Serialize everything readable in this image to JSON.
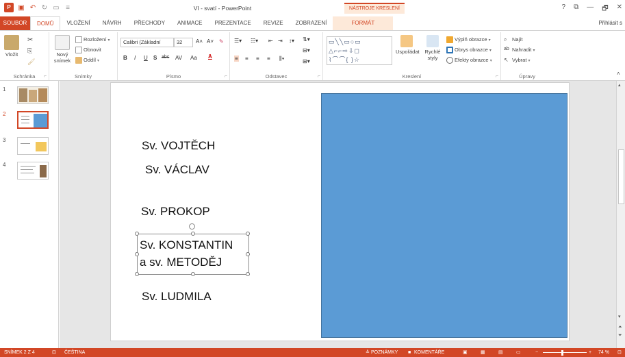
{
  "window": {
    "title": "VI - svatí - PowerPoint",
    "context_header": "NÁSTROJE KRESLENÍ",
    "controls": [
      "?",
      "⧉",
      "—",
      "🗗",
      "✕"
    ]
  },
  "tabs": [
    {
      "label": "SOUBOR"
    },
    {
      "label": "DOMŮ"
    },
    {
      "label": "VLOŽENÍ"
    },
    {
      "label": "NÁVRH"
    },
    {
      "label": "PŘECHODY"
    },
    {
      "label": "ANIMACE"
    },
    {
      "label": "PREZENTACE"
    },
    {
      "label": "REVIZE"
    },
    {
      "label": "ZOBRAZENÍ"
    },
    {
      "label": "FORMÁT"
    }
  ],
  "signin": "Přihlásit s",
  "ribbon": {
    "clipboard": {
      "paste": "Vložit",
      "group": "Schránka"
    },
    "slides": {
      "new_slide": "Nový snímek",
      "layout": "Rozložení",
      "reset": "Obnovit",
      "section": "Oddíl",
      "group": "Snímky"
    },
    "font": {
      "font_name": "Calibri (Základní",
      "font_size": "32",
      "bold": "B",
      "italic": "I",
      "underline": "U",
      "shadow": "S",
      "strike": "abc",
      "spacing": "AV",
      "case": "Aa",
      "group": "Písmo"
    },
    "paragraph": {
      "group": "Odstavec"
    },
    "drawing": {
      "arrange": "Uspořádat",
      "quick_styles": "Rychlé styly",
      "fill": "Výplň obrazce",
      "outline": "Obrys obrazce",
      "effects": "Efekty obrazce",
      "group": "Kreslení"
    },
    "editing": {
      "find": "Najít",
      "replace": "Nahradit",
      "select": "Vybrat",
      "group": "Úpravy"
    }
  },
  "thumbnails": [
    {
      "number": "1"
    },
    {
      "number": "2"
    },
    {
      "number": "3"
    },
    {
      "number": "4"
    }
  ],
  "slide": {
    "lines": [
      "Sv. VOJTĚCH",
      "Sv. VÁCLAV",
      "Sv. PROKOP",
      "Sv. KONSTANTIN",
      "a sv. METODĚJ",
      "Sv. LUDMILA"
    ],
    "shape_color": "#5b9bd5"
  },
  "status": {
    "slide_indicator": "SNÍMEK 2 Z 4",
    "language": "ČEŠTINA",
    "notes": "POZNÁMKY",
    "comments": "KOMENTÁŘE",
    "zoom": "74 %"
  },
  "colors": {
    "accent": "#d24726",
    "context_bg": "#fde9d9"
  }
}
